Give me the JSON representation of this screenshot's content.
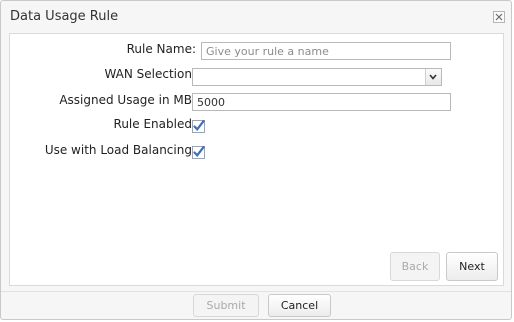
{
  "dialog": {
    "title": "Data Usage Rule",
    "close_icon": "close-icon"
  },
  "form": {
    "rule_name": {
      "label": "Rule Name:",
      "value": "",
      "placeholder": "Give your rule a name"
    },
    "wan_selection": {
      "label": "WAN Selection:",
      "value": ""
    },
    "assigned_usage": {
      "label": "Assigned Usage in MB:",
      "value": "5000"
    },
    "rule_enabled": {
      "label": "Rule Enabled:",
      "checked": true
    },
    "load_balancing": {
      "label": "Use with Load Balancing:",
      "checked": true
    }
  },
  "wizard": {
    "back_label": "Back",
    "next_label": "Next"
  },
  "footer": {
    "submit_label": "Submit",
    "cancel_label": "Cancel"
  },
  "colors": {
    "checkbox_accent": "#3d6fb6",
    "panel_background": "#ffffff",
    "dialog_background": "#f6f6f6"
  }
}
